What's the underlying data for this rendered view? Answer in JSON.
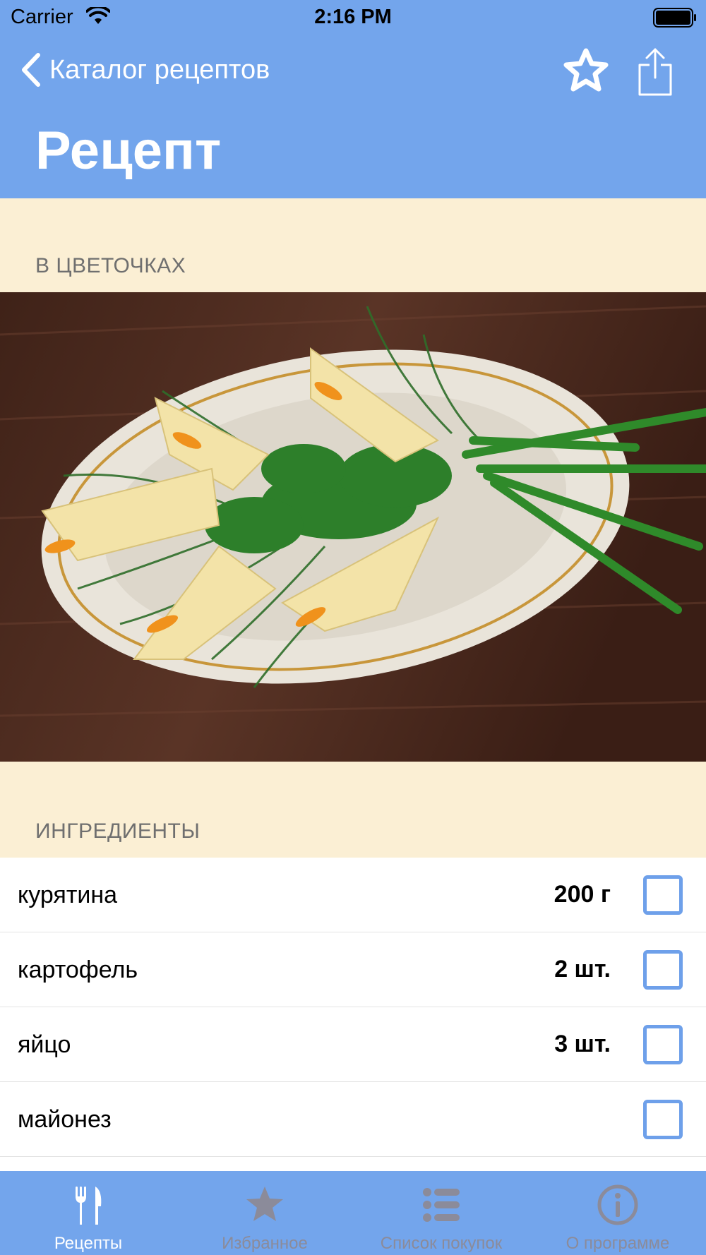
{
  "status_bar": {
    "carrier": "Carrier",
    "time": "2:16 PM"
  },
  "nav": {
    "back_label": "Каталог рецептов",
    "back_icon": "chevron-left-icon",
    "favorite_icon": "star-outline-icon",
    "share_icon": "share-icon"
  },
  "page": {
    "title": "Рецепт"
  },
  "recipe": {
    "name": "В ЦВЕТОЧКАХ"
  },
  "ingredients": {
    "header": "ИНГРЕДИЕНТЫ",
    "items": [
      {
        "name": "курятина",
        "quantity": "200 г",
        "checked": false
      },
      {
        "name": "картофель",
        "quantity": "2 шт.",
        "checked": false
      },
      {
        "name": "яйцо",
        "quantity": "3 шт.",
        "checked": false
      },
      {
        "name": "майонез",
        "quantity": "",
        "checked": false
      }
    ]
  },
  "tab_bar": {
    "tabs": [
      {
        "label": "Рецепты",
        "icon": "fork-knife-icon",
        "active": true
      },
      {
        "label": "Избранное",
        "icon": "star-icon",
        "active": false
      },
      {
        "label": "Список покупок",
        "icon": "list-icon",
        "active": false
      },
      {
        "label": "О программе",
        "icon": "info-icon",
        "active": false
      }
    ]
  },
  "colors": {
    "header_bg": "#73a5ec",
    "page_bg": "#fbefd4",
    "checkbox_border": "#6ea0ea",
    "tab_inactive": "#8b8b9a"
  }
}
